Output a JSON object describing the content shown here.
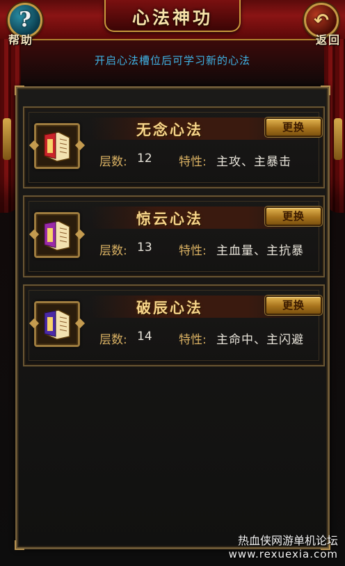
{
  "header": {
    "title": "心法神功",
    "help_label": "帮助",
    "back_label": "返回"
  },
  "hint": "开启心法槽位后可学习新的心法",
  "arts": [
    {
      "name": "无念心法",
      "level_label": "层数:",
      "level": "12",
      "trait_label": "特性:",
      "traits": "主攻、主暴击",
      "change_label": "更换",
      "icon_color": "#c9242a",
      "icon": "red-scroll-icon"
    },
    {
      "name": "惊云心法",
      "level_label": "层数:",
      "level": "13",
      "trait_label": "特性:",
      "traits": "主血量、主抗暴",
      "change_label": "更换",
      "icon_color": "#9a2aa8",
      "icon": "purple-scroll-icon"
    },
    {
      "name": "破辰心法",
      "level_label": "层数:",
      "level": "14",
      "trait_label": "特性:",
      "traits": "主命中、主闪避",
      "change_label": "更换",
      "icon_color": "#4b2aa6",
      "icon": "indigo-scroll-icon"
    }
  ],
  "watermark": {
    "line1": "热血侠网游单机论坛",
    "line2": "www.rexuexia.com"
  },
  "colors": {
    "accent_gold": "#c99a3c",
    "hint_blue": "#3fb4e6",
    "banner_red": "#8a1414"
  }
}
